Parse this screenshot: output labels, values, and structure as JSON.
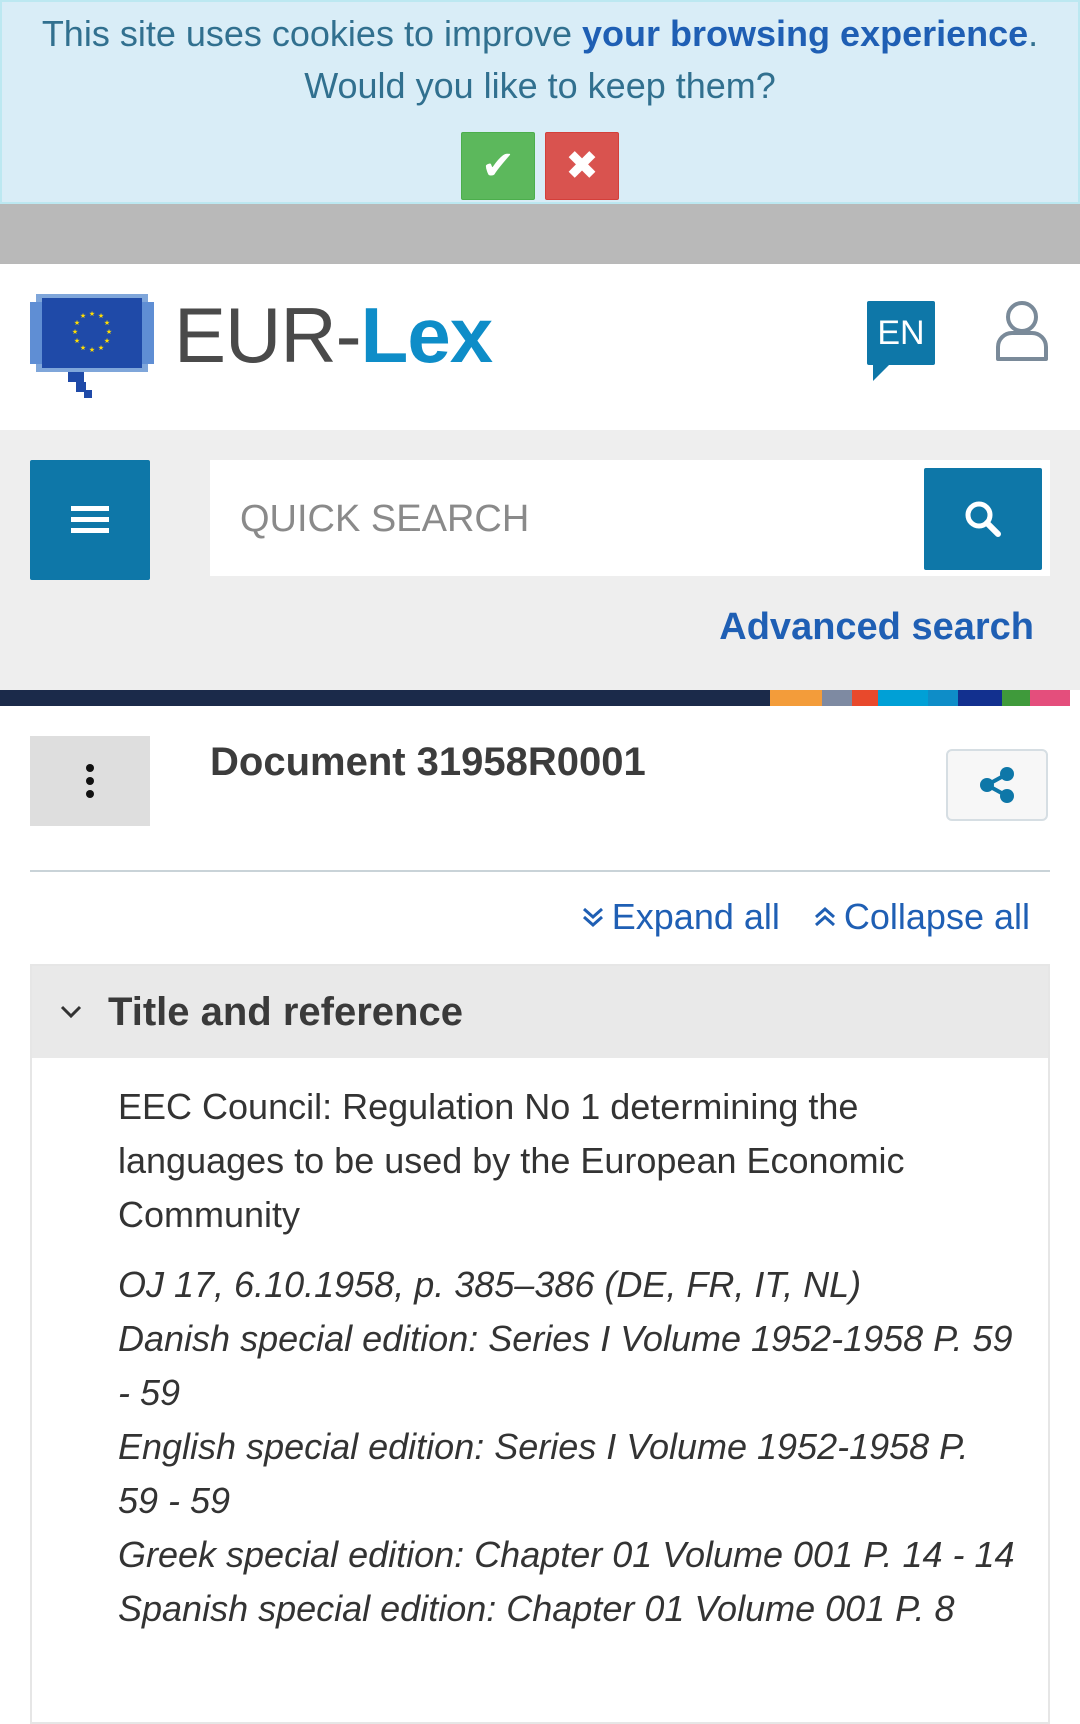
{
  "cookie": {
    "text_before": "This site uses cookies to improve ",
    "link_text": "your browsing experience",
    "text_after": ".",
    "question": "Would you like to keep them?",
    "accept_glyph": "✔",
    "decline_glyph": "✖"
  },
  "header": {
    "logo_icon": "eu-flag-icon",
    "brand_part1": "EUR-",
    "brand_part2": "Lex",
    "language": "EN"
  },
  "search": {
    "placeholder": "QUICK SEARCH",
    "advanced_label": "Advanced search"
  },
  "colorbar": [
    "#1b2a4a",
    "#f39c3a",
    "#7e8aa2",
    "#e8492c",
    "#00a0d6",
    "#0e8dc8",
    "#12308f",
    "#3f9a3b",
    "#e44e7c"
  ],
  "document": {
    "title": "Document 31958R0001",
    "expand_all": "Expand all",
    "collapse_all": "Collapse all",
    "section_title": "Title and reference",
    "doc_title_text": "EEC Council: Regulation No 1 determining the languages to be used by the European Economic Community",
    "references": [
      "OJ 17, 6.10.1958, p. 385–386 (DE, FR, IT, NL)",
      "Danish special edition: Series I Volume 1952-1958 P. 59 - 59",
      "English special edition: Series I Volume 1952-1958 P. 59 - 59",
      "Greek special edition: Chapter 01 Volume 001 P. 14 - 14",
      "Spanish special edition: Chapter 01 Volume 001 P. 8"
    ]
  }
}
